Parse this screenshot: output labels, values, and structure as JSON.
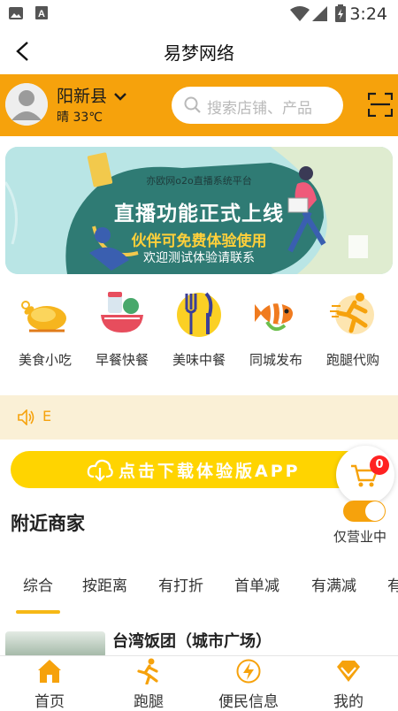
{
  "status_bar": {
    "time": "3:24"
  },
  "title_bar": {
    "title": "易梦网络"
  },
  "location": {
    "city": "阳新县",
    "weather": "晴 33℃"
  },
  "search": {
    "placeholder": "搜索店铺、产品"
  },
  "banner": {
    "line_small": "亦欧网o2o直播系统平台",
    "line_big": "直播功能正式上线",
    "line_yellow": "伙伴可免费体验使用",
    "line_white": "欢迎测试体验请联系"
  },
  "categories": [
    {
      "label": "美食小吃",
      "icon": "roast-chicken-icon"
    },
    {
      "label": "早餐快餐",
      "icon": "breakfast-bowl-icon"
    },
    {
      "label": "美味中餐",
      "icon": "fork-knife-icon"
    },
    {
      "label": "同城发布",
      "icon": "clownfish-icon"
    },
    {
      "label": "跑腿代购",
      "icon": "runner-icon"
    }
  ],
  "notice": {
    "icon": "speaker-icon",
    "text": "E"
  },
  "download": {
    "label": "点击下载体验版APP",
    "icon": "cloud-download-icon"
  },
  "cart": {
    "badge": "0"
  },
  "nearby": {
    "title": "附近商家",
    "open_only_label": "仅营业中",
    "open_only": true
  },
  "filter_tabs": [
    "综合",
    "按距离",
    "有打折",
    "首单减",
    "有满减",
    "有"
  ],
  "shop": {
    "name": "台湾饭团（城市广场）"
  },
  "tabbar": [
    {
      "label": "首页",
      "icon": "home-icon",
      "active": true
    },
    {
      "label": "跑腿",
      "icon": "runner-icon"
    },
    {
      "label": "便民信息",
      "icon": "lightning-icon"
    },
    {
      "label": "我的",
      "icon": "diamond-icon"
    }
  ],
  "colors": {
    "accent": "#f6a20c",
    "download_button": "#ffd400",
    "badge": "#ff2222"
  }
}
